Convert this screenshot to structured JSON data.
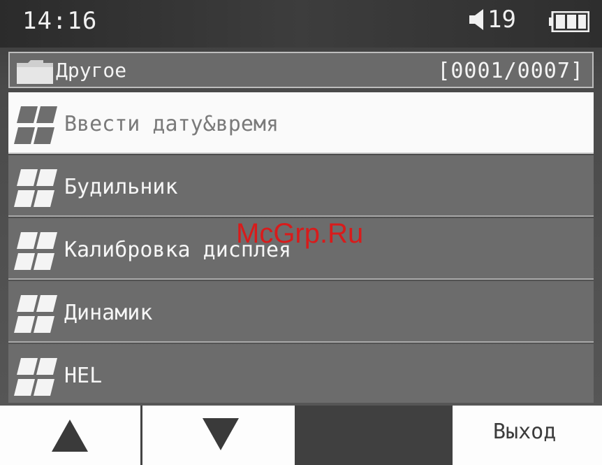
{
  "status": {
    "time": "14:16",
    "volume_level": "19",
    "volume_icon": "speaker-icon",
    "battery_icon": "battery-full-icon"
  },
  "folder": {
    "icon": "folder-icon",
    "name": "Другое",
    "counter": "[0001/0007]"
  },
  "menu": {
    "items": [
      {
        "label": "Ввести дату&время",
        "icon": "tile-grid-icon",
        "selected": true
      },
      {
        "label": "Будильник",
        "icon": "tile-grid-icon",
        "selected": false
      },
      {
        "label": "Калибровка дисплея",
        "icon": "tile-grid-icon",
        "selected": false
      },
      {
        "label": "Динамик",
        "icon": "tile-grid-icon",
        "selected": false
      },
      {
        "label": "HEL",
        "icon": "tile-grid-icon",
        "selected": false
      }
    ]
  },
  "watermark": "McGrp.Ru",
  "softkeys": {
    "up_icon": "triangle-up-icon",
    "down_icon": "triangle-down-icon",
    "exit_label": "Выход"
  },
  "colors": {
    "selected_bg": "#fafafa",
    "item_bg": "#6c6c6c",
    "watermark": "#d81b1b"
  }
}
